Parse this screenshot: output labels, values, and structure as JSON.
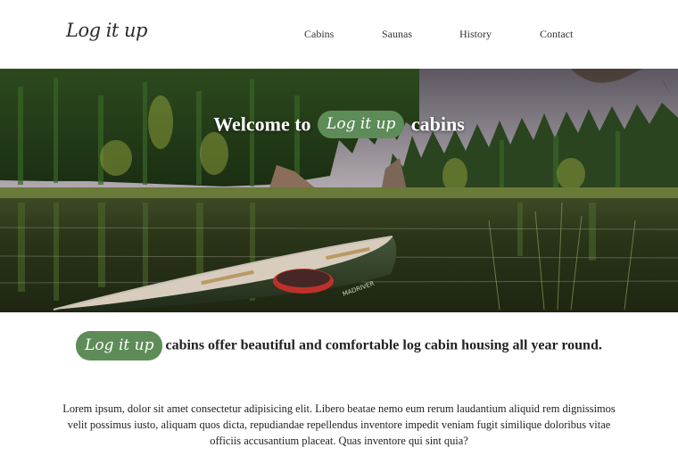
{
  "header": {
    "logo": "Log it up",
    "nav": [
      "Cabins",
      "Saunas",
      "History",
      "Contact"
    ]
  },
  "hero": {
    "prefix": "Welcome to",
    "brand": "Log it up",
    "suffix": "cabins",
    "canoe_label": "MADRIVER"
  },
  "tagline": {
    "brand": "Log it up",
    "text": "cabins offer beautiful and comfortable log cabin housing all year round."
  },
  "body": {
    "paragraph": "Lorem ipsum, dolor sit amet consectetur adipisicing elit. Libero beatae nemo eum rerum laudantium aliquid rem dignissimos velit possimus iusto, aliquam quos dicta, repudiandae repellendus inventore impedit veniam fugit similique doloribus vitae officiis accusantium placeat. Quas inventore qui sint quia?"
  },
  "colors": {
    "accent_green": "#5e8c58",
    "text": "#222222"
  }
}
